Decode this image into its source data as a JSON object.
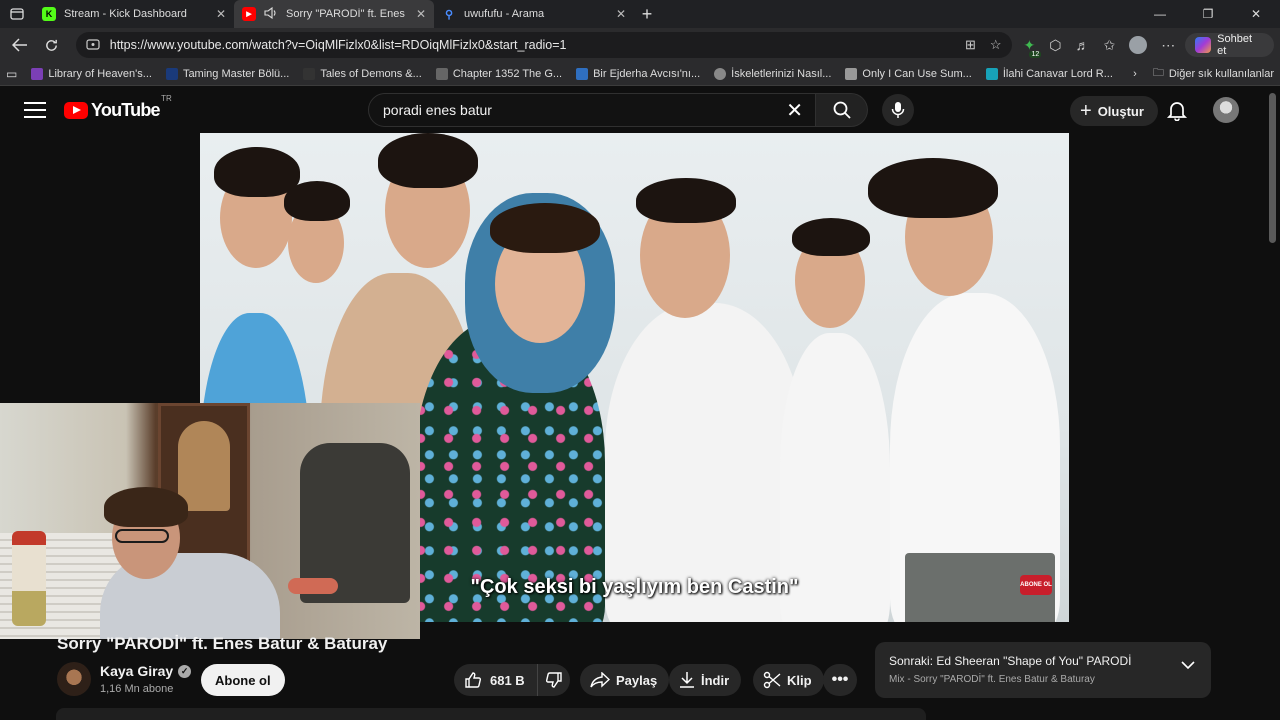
{
  "browser": {
    "tabs": [
      {
        "title": "Stream - Kick Dashboard",
        "favicon_color": "#53fc18",
        "favicon_letter": "K"
      },
      {
        "title": "Sorry \"PARODİ\" ft. Enes Batur & Baturay",
        "favicon_color": "#ff0000",
        "favicon_letter": "▶"
      },
      {
        "title": "uwufufu - Arama",
        "favicon_color": "#2b2b2d",
        "favicon_letter": "⚲"
      }
    ],
    "url": "https://www.youtube.com/watch?v=OiqMlFizlx0&list=RDOiqMlFizlx0&start_radio=1",
    "extension_badge": "12",
    "copilot_label": "Sohbet et",
    "bookmarks": [
      {
        "label": "Library of Heaven's...",
        "color": "#7b3fb5"
      },
      {
        "label": "Taming Master Bölü...",
        "color": "#1a3a7a"
      },
      {
        "label": "Tales of Demons &...",
        "color": "#333333"
      },
      {
        "label": "Chapter 1352 The G...",
        "color": "#666666"
      },
      {
        "label": "Bir Ejderha Avcısı'nı...",
        "color": "#2f6fc0"
      },
      {
        "label": "İskeletlerinizi Nasıl...",
        "color": "#888888"
      },
      {
        "label": "Only I Can Use Sum...",
        "color": "#999999"
      },
      {
        "label": "İlahi Canavar Lord R...",
        "color": "#17a2b8"
      }
    ],
    "other_bookmarks": "Diğer sık kullanılanlar"
  },
  "youtube": {
    "logo_text": "YouTube",
    "country": "TR",
    "search_query": "poradi enes batur",
    "create_label": "Oluştur"
  },
  "video": {
    "subtitle": "\"Çok seksi bi yaşlıyım ben Castin\"",
    "watermark": "ABONE OL",
    "title": "Sorry \"PARODİ\" ft. Enes Batur & Baturay",
    "channel": "Kaya Giray",
    "subscribers": "1,16 Mn abone",
    "subscribe_label": "Abone ol",
    "likes": "681 B",
    "share_label": "Paylaş",
    "download_label": "İndir",
    "clip_label": "Klip"
  },
  "next_up": {
    "title": "Sonraki: Ed Sheeran \"Shape of You\" PARODİ",
    "subtitle": "Mix - Sorry \"PARODİ\" ft. Enes Batur & Baturay"
  }
}
